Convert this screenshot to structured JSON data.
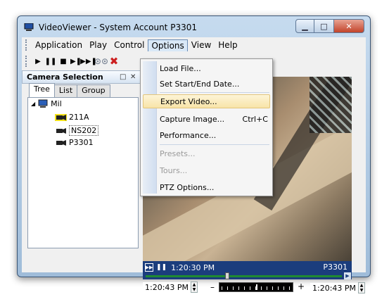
{
  "window": {
    "title": "VideoViewer - System Account P3301"
  },
  "menubar": {
    "items": [
      "Application",
      "Play",
      "Control",
      "Options",
      "View",
      "Help"
    ],
    "active": "Options"
  },
  "toolbar": {
    "buttons": [
      "play",
      "pause",
      "stop",
      "step-pause",
      "step-forward",
      "binoculars",
      "close"
    ]
  },
  "camera_panel": {
    "title": "Camera Selection",
    "tabs": [
      "Tree",
      "List",
      "Group"
    ],
    "selected_tab": "Tree",
    "tree": {
      "root": "Mil",
      "children": [
        "211A",
        "NS202",
        "P3301"
      ],
      "selected": "NS202"
    }
  },
  "player": {
    "time": "1:20:30 PM",
    "camera": "P3301",
    "start_time": "1:20:43 PM",
    "end_time": "1:20:43 PM",
    "zoom_minus": "–",
    "zoom_plus": "+"
  },
  "options_menu": {
    "items": [
      {
        "label": "Load File...",
        "shortcut": "",
        "disabled": false
      },
      {
        "label": "Set Start/End Date...",
        "shortcut": "",
        "disabled": false
      },
      {
        "label": "Export Video...",
        "shortcut": "",
        "disabled": false,
        "highlighted": true
      },
      {
        "label": "Capture Image...",
        "shortcut": "Ctrl+C",
        "disabled": false
      },
      {
        "label": "Performance...",
        "shortcut": "",
        "disabled": false
      },
      {
        "label": "Presets...",
        "shortcut": "",
        "disabled": true
      },
      {
        "label": "Tours...",
        "shortcut": "",
        "disabled": true
      },
      {
        "label": "PTZ Options...",
        "shortcut": "",
        "disabled": false
      }
    ]
  },
  "colors": {
    "highlight": "#f8e4a8",
    "playbar": "#1b3d7d",
    "timeline": "#1f8a32",
    "close_x": "#cc1f1f"
  }
}
